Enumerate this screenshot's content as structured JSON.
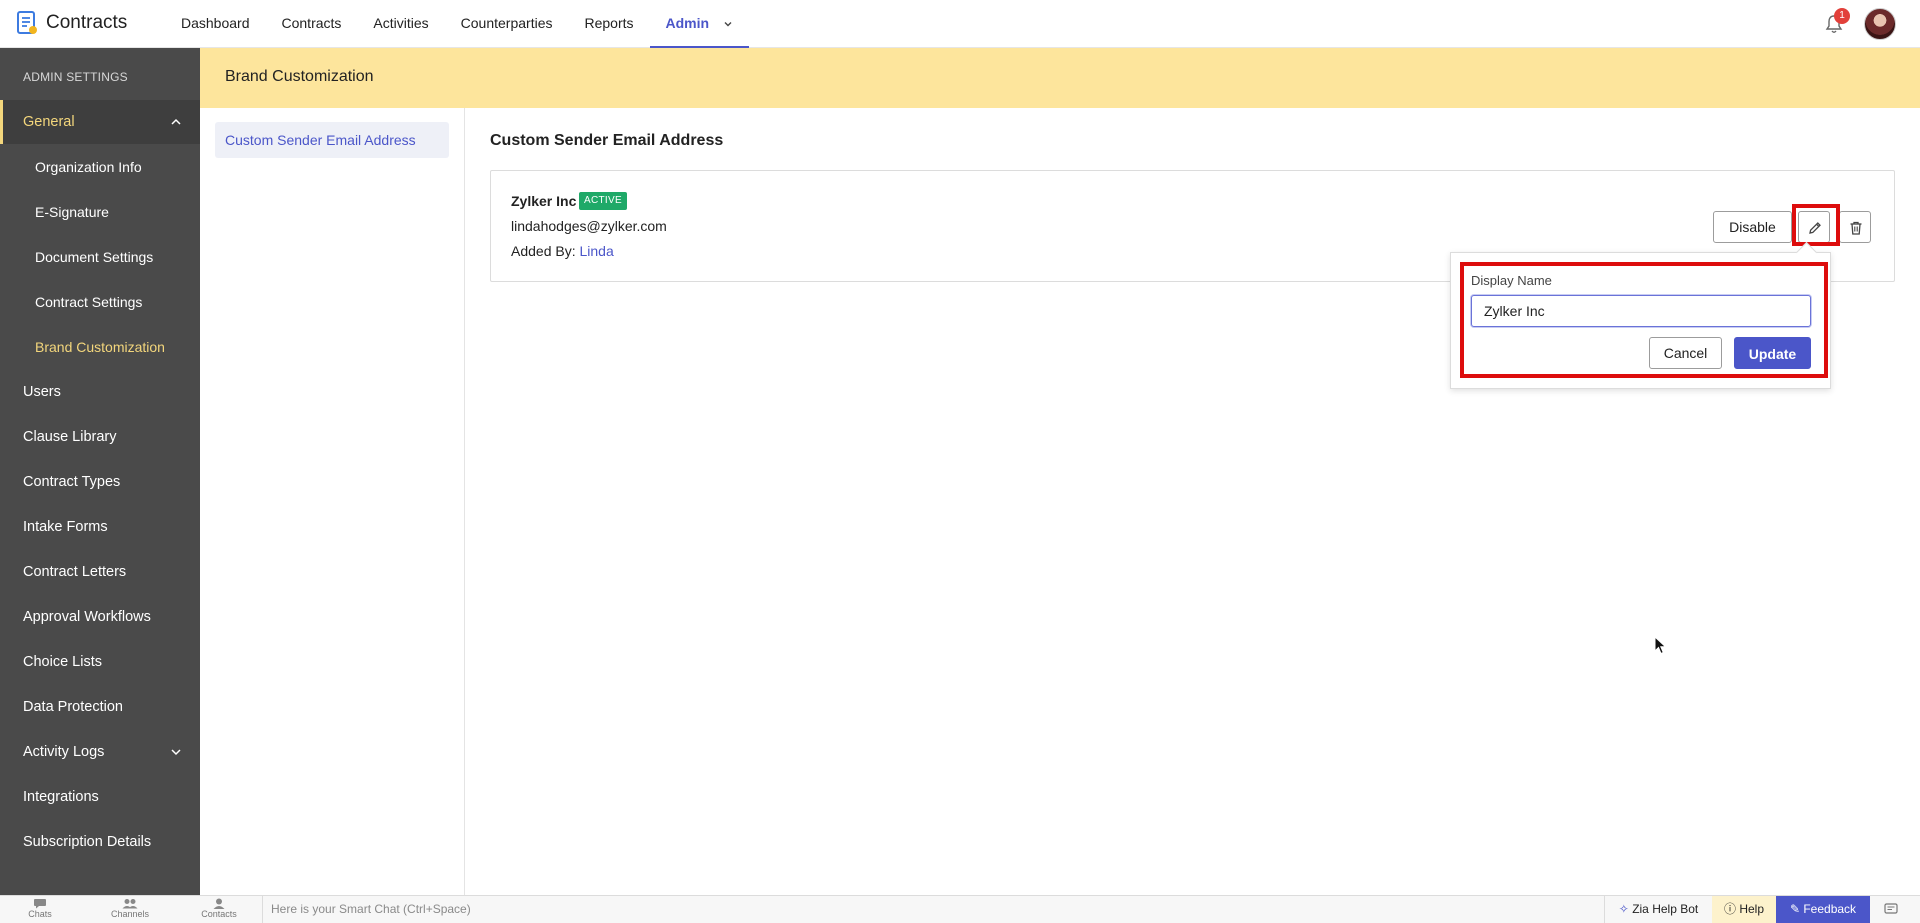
{
  "app": {
    "name": "Contracts"
  },
  "nav": {
    "items": [
      "Dashboard",
      "Contracts",
      "Activities",
      "Counterparties",
      "Reports",
      "Admin"
    ],
    "active": "Admin",
    "notification_count": "1"
  },
  "sidebar": {
    "heading": "ADMIN SETTINGS",
    "general": "General",
    "general_children": [
      "Organization Info",
      "E-Signature",
      "Document Settings",
      "Contract Settings",
      "Brand Customization"
    ],
    "items": [
      "Users",
      "Clause Library",
      "Contract Types",
      "Intake Forms",
      "Contract Letters",
      "Approval Workflows",
      "Choice Lists",
      "Data Protection",
      "Activity Logs",
      "Integrations",
      "Subscription Details"
    ]
  },
  "page": {
    "title": "Brand Customization",
    "subnav_item": "Custom Sender Email Address",
    "section_title": "Custom Sender Email Address"
  },
  "sender": {
    "name": "Zylker Inc",
    "status": "ACTIVE",
    "email": "lindahodges@zylker.com",
    "added_by_label": "Added By:",
    "added_by_user": "Linda",
    "disable_label": "Disable"
  },
  "edit_popover": {
    "label": "Display Name",
    "value": "Zylker Inc",
    "cancel_label": "Cancel",
    "update_label": "Update"
  },
  "bottombar": {
    "chats": "Chats",
    "channels": "Channels",
    "contacts": "Contacts",
    "smartchat_placeholder": "Here is your Smart Chat (Ctrl+Space)",
    "zia": "Zia Help Bot",
    "help": "Help",
    "feedback": "Feedback"
  },
  "colors": {
    "accent": "#4b56c9",
    "sidebar_bg": "#4a4a4a",
    "header_band": "#fde59c",
    "active_badge": "#1fa968",
    "highlight": "#dd0d0d"
  }
}
